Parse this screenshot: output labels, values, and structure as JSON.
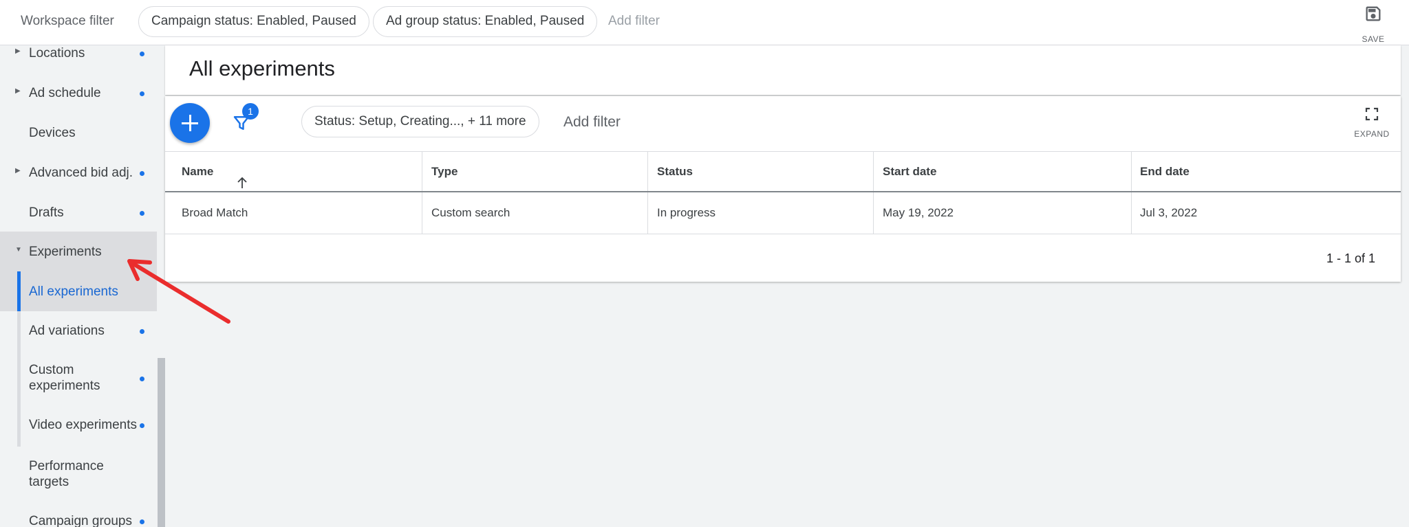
{
  "topbar": {
    "workspace_label": "Workspace filter",
    "chips": [
      "Campaign status: Enabled, Paused",
      "Ad group status: Enabled, Paused"
    ],
    "add_filter": "Add filter",
    "save_label": "SAVE"
  },
  "sidebar": {
    "items": [
      {
        "label": "Locations",
        "caret": "▶",
        "dot": true
      },
      {
        "label": "Ad schedule",
        "caret": "▶",
        "dot": true
      },
      {
        "label": "Devices",
        "caret": "",
        "dot": false
      },
      {
        "label": "Advanced bid adj.",
        "caret": "▶",
        "dot": true
      },
      {
        "label": "Drafts",
        "caret": "",
        "dot": true
      },
      {
        "label": "Experiments",
        "caret": "▼",
        "dot": false
      },
      {
        "label": "All experiments",
        "caret": "",
        "dot": false
      },
      {
        "label": "Ad variations",
        "caret": "",
        "dot": true
      },
      {
        "label": "Custom experiments",
        "caret": "",
        "dot": true
      },
      {
        "label": "Video experiments",
        "caret": "",
        "dot": true
      },
      {
        "label": "Performance targets",
        "caret": "",
        "dot": false
      },
      {
        "label": "Campaign groups",
        "caret": "",
        "dot": true
      }
    ]
  },
  "main": {
    "title": "All experiments",
    "filter_badge": "1",
    "status_chip": "Status: Setup, Creating..., + 11 more",
    "add_filter": "Add filter",
    "expand_label": "EXPAND",
    "columns": [
      "Name",
      "Type",
      "Status",
      "Start date",
      "End date"
    ],
    "rows": [
      {
        "name": "Broad Match",
        "type": "Custom search",
        "status": "In progress",
        "start": "May 19, 2022",
        "end": "Jul 3, 2022"
      }
    ],
    "pagination": "1 - 1 of 1"
  },
  "colors": {
    "accent": "#1a73e8",
    "link": "#1967d2",
    "annotation_arrow": "#ea2d2d"
  }
}
